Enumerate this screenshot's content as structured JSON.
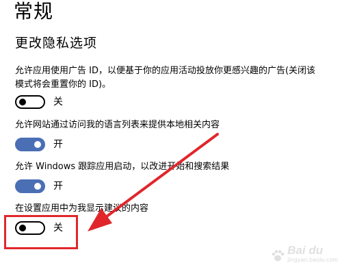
{
  "page": {
    "title": "常规",
    "section_title": "更改隐私选项"
  },
  "settings": [
    {
      "description": "允许应用使用广告 ID，以便基于你的应用活动投放你更感兴趣的广告(关闭该模式将会重置你的 ID)。",
      "state": "off",
      "state_label": "关"
    },
    {
      "description": "允许网站通过访问我的语言列表来提供本地相关内容",
      "state": "on",
      "state_label": "开"
    },
    {
      "description": "允许 Windows 跟踪应用启动，以改进开始和搜索结果",
      "state": "on",
      "state_label": "开"
    },
    {
      "description": "在设置应用中为我显示建议的内容",
      "state": "off",
      "state_label": "关"
    }
  ],
  "annotation": {
    "color": "#e0262b"
  },
  "watermark": {
    "brand": "Bai du",
    "sub": "jingyan.baidu.com"
  },
  "colors": {
    "toggle_on": "#4a6fb5",
    "toggle_off_border": "#000000",
    "background": "#ffffff"
  }
}
